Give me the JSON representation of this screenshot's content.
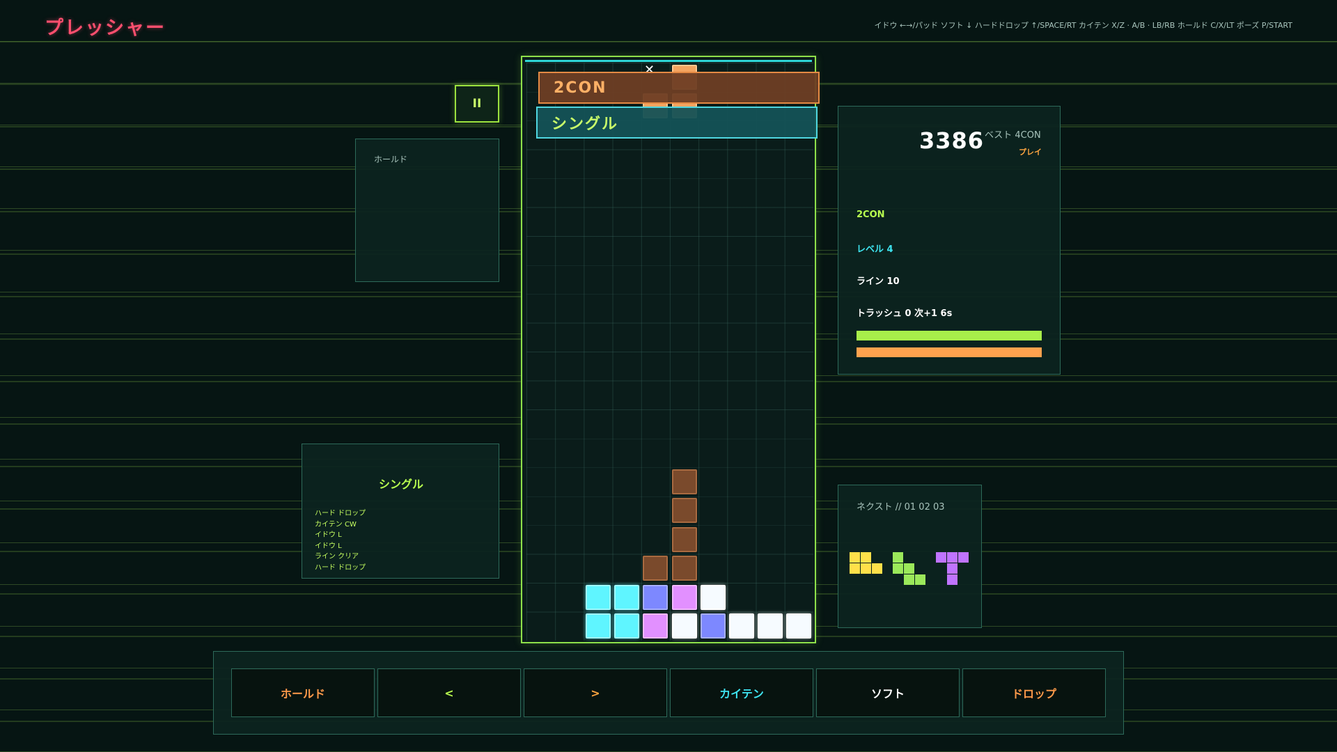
{
  "app": {
    "title": "プレッシャー"
  },
  "controls_hint": "イドウ ←→/パッド  ソフト ↓  ハードドロップ ↑/SPACE/RT  カイテン X/Z · A/B · LB/RB  ホールド C/X/LT  ポーズ P/START",
  "pause": {
    "label": "II"
  },
  "hold": {
    "label": "ホールド"
  },
  "log": {
    "title": "シングル",
    "entries": [
      "ハード ドロップ",
      "カイテン CW",
      "イドウ L",
      "イドウ L",
      "ライン クリア",
      "ハード ドロップ"
    ]
  },
  "banners": {
    "combo": "2CON",
    "clear": "シングル"
  },
  "score": {
    "value": "3386",
    "best": "ベスト 4CON",
    "mode": "プレイ",
    "combo": "2CON",
    "level": "レベル  4",
    "lines": "ライン  10",
    "trash": "トラッシュ  0  次+1  6s",
    "bar_green_fill": 1.0,
    "bar_orange_fill": 1.0
  },
  "next": {
    "label": "ネクスト // 01 02 03",
    "pieces": [
      "O",
      "S",
      "T"
    ],
    "colors": {
      "O": "#ffe04a",
      "S": "#9be85a",
      "T": "#c074ff"
    }
  },
  "icons": {
    "spike": "x-mark-icon"
  },
  "board": {
    "cols": 10,
    "rows": 20,
    "cells": [
      {
        "c": 5,
        "r": 0,
        "k": "orange"
      },
      {
        "c": 4,
        "r": 1,
        "k": "orange"
      },
      {
        "c": 5,
        "r": 1,
        "k": "orange"
      },
      {
        "c": 5,
        "r": 14,
        "k": "brown"
      },
      {
        "c": 5,
        "r": 15,
        "k": "brown"
      },
      {
        "c": 5,
        "r": 16,
        "k": "brown"
      },
      {
        "c": 4,
        "r": 17,
        "k": "brown"
      },
      {
        "c": 5,
        "r": 17,
        "k": "brown"
      },
      {
        "c": 2,
        "r": 18,
        "k": "cyan"
      },
      {
        "c": 3,
        "r": 18,
        "k": "cyan"
      },
      {
        "c": 4,
        "r": 18,
        "k": "blue"
      },
      {
        "c": 5,
        "r": 18,
        "k": "pink"
      },
      {
        "c": 6,
        "r": 18,
        "k": "white"
      },
      {
        "c": 2,
        "r": 19,
        "k": "cyan"
      },
      {
        "c": 3,
        "r": 19,
        "k": "cyan"
      },
      {
        "c": 4,
        "r": 19,
        "k": "pink"
      },
      {
        "c": 5,
        "r": 19,
        "k": "white"
      },
      {
        "c": 6,
        "r": 19,
        "k": "blue"
      },
      {
        "c": 7,
        "r": 19,
        "k": "white"
      },
      {
        "c": 8,
        "r": 19,
        "k": "white"
      },
      {
        "c": 9,
        "r": 19,
        "k": "white"
      }
    ]
  },
  "control_buttons": [
    {
      "label": "ホールド",
      "color": "#ff9a4a"
    },
    {
      "label": "<",
      "color": "#b8ff4f"
    },
    {
      "label": ">",
      "color": "#ffa640"
    },
    {
      "label": "カイテン",
      "color": "#3ee4f0"
    },
    {
      "label": "ソフト",
      "color": "#ffffff"
    },
    {
      "label": "ドロップ",
      "color": "#ff9a4a"
    }
  ]
}
